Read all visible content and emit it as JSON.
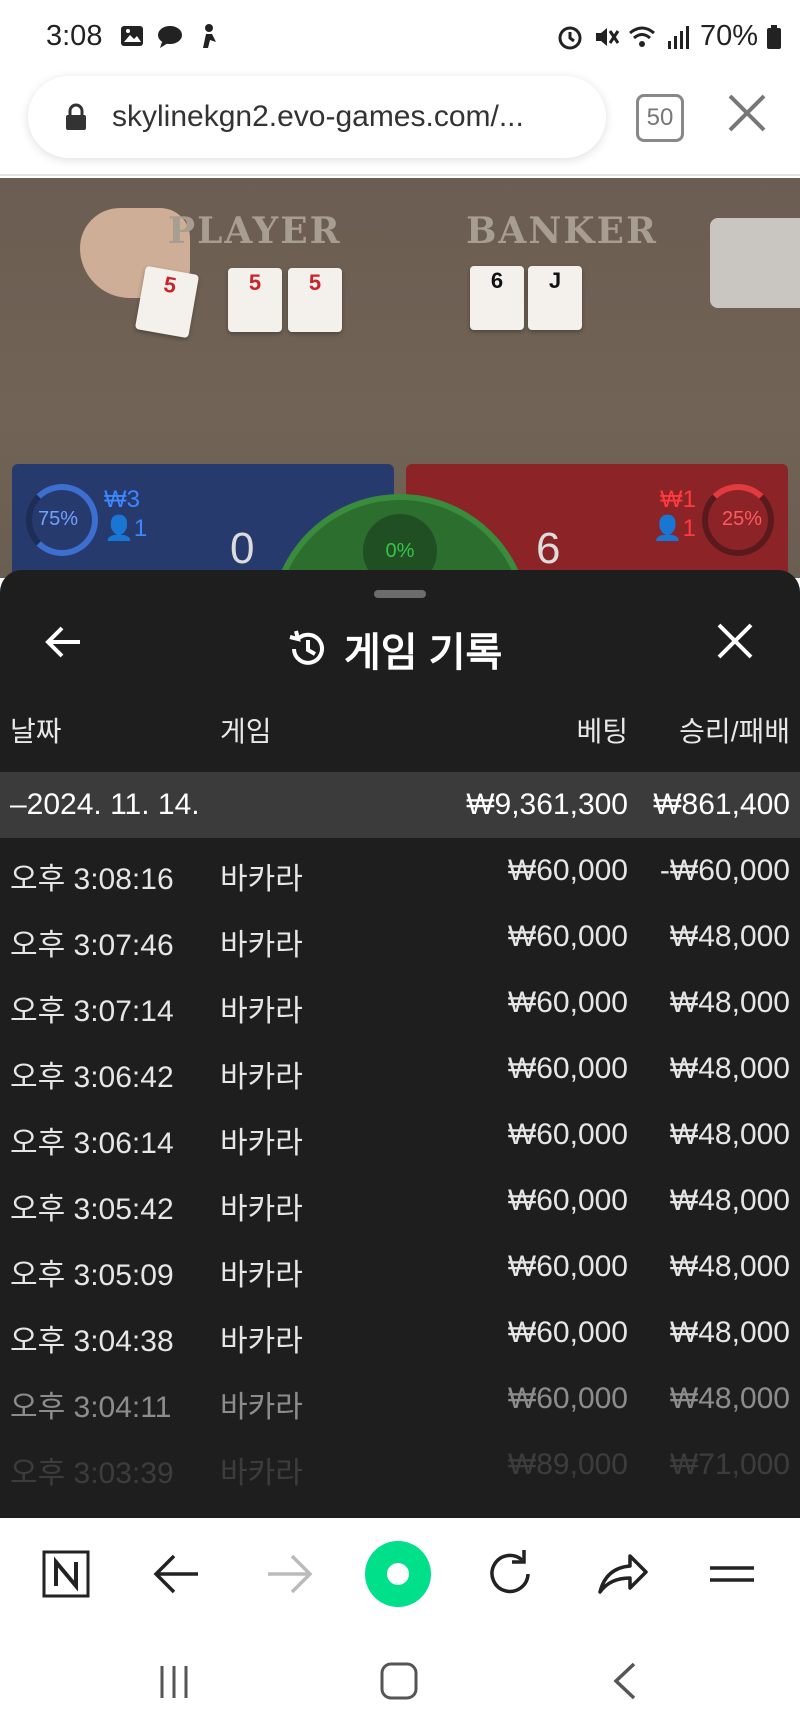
{
  "status_bar": {
    "time": "3:08",
    "battery": "70%"
  },
  "browser": {
    "url": "skylinekgn2.evo-games.com/...",
    "tab_count": "50"
  },
  "game": {
    "player_label": "PLAYER",
    "banker_label": "BANKER",
    "player_cards": [
      "5",
      "5",
      "5"
    ],
    "banker_cards": [
      "6",
      "J"
    ],
    "player_pct": "75%",
    "player_bet": "₩3",
    "player_users": "1",
    "player_score": "0",
    "tie_pct": "0%",
    "banker_score": "6",
    "banker_bet": "₩1",
    "banker_users": "1",
    "banker_pct": "25%"
  },
  "history": {
    "title": "게임 기록",
    "columns": {
      "date": "날짜",
      "game": "게임",
      "bet": "베팅",
      "winloss": "승리/패배"
    },
    "day": {
      "date": "–2024. 11. 14.",
      "bet": "₩9,361,300",
      "winloss": "₩861,400"
    },
    "rows": [
      {
        "time": "오후 3:08:16",
        "game": "바카라",
        "bet": "₩60,000",
        "winloss": "-₩60,000"
      },
      {
        "time": "오후 3:07:46",
        "game": "바카라",
        "bet": "₩60,000",
        "winloss": "₩48,000"
      },
      {
        "time": "오후 3:07:14",
        "game": "바카라",
        "bet": "₩60,000",
        "winloss": "₩48,000"
      },
      {
        "time": "오후 3:06:42",
        "game": "바카라",
        "bet": "₩60,000",
        "winloss": "₩48,000"
      },
      {
        "time": "오후 3:06:14",
        "game": "바카라",
        "bet": "₩60,000",
        "winloss": "₩48,000"
      },
      {
        "time": "오후 3:05:42",
        "game": "바카라",
        "bet": "₩60,000",
        "winloss": "₩48,000"
      },
      {
        "time": "오후 3:05:09",
        "game": "바카라",
        "bet": "₩60,000",
        "winloss": "₩48,000"
      },
      {
        "time": "오후 3:04:38",
        "game": "바카라",
        "bet": "₩60,000",
        "winloss": "₩48,000"
      },
      {
        "time": "오후 3:04:11",
        "game": "바카라",
        "bet": "₩60,000",
        "winloss": "₩48,000"
      },
      {
        "time": "오후 3:03:39",
        "game": "바카라",
        "bet": "₩89,000",
        "winloss": "₩71,000"
      }
    ]
  },
  "icons": {
    "back": "arrow-left-icon",
    "history": "history-icon",
    "close": "close-icon"
  },
  "colors": {
    "sheet_bg": "#1e1e1e",
    "day_row_bg": "#3b3b3b",
    "player_blue": "#273a6e",
    "banker_red": "#8c2327",
    "accent_green": "#00e08a"
  }
}
